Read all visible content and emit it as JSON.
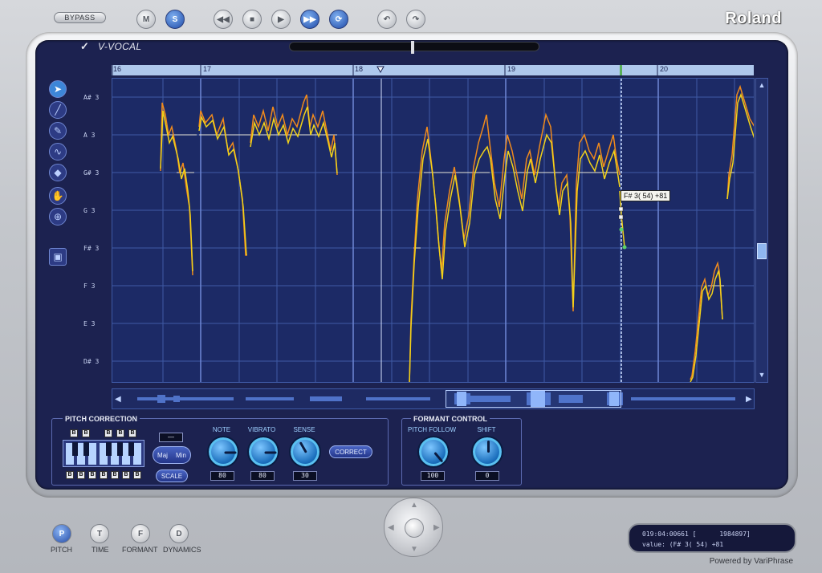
{
  "header": {
    "bypass_label": "BYPASS",
    "mute_label": "M",
    "solo_label": "S",
    "brand": "Roland",
    "plugin_title": "V-VOCAL"
  },
  "timeline": {
    "ruler_ticks": [
      "16",
      "17",
      "18",
      "19",
      "20"
    ]
  },
  "pitch_axis": {
    "labels": [
      "A# 3",
      "A 3",
      "G# 3",
      "G 3",
      "F# 3",
      "F 3",
      "E 3",
      "D# 3"
    ]
  },
  "tooltip": {
    "text": "F# 3( 54) +81"
  },
  "pitch_correction": {
    "title": "PITCH CORRECTION",
    "top_b_labels": [
      "B",
      "B",
      "B",
      "B",
      "B"
    ],
    "bottom_b_labels": [
      "B",
      "B",
      "B",
      "B",
      "B",
      "B",
      "B"
    ],
    "scale_value": "—",
    "maj_label": "Maj",
    "min_label": "Min",
    "scale_label": "SCALE",
    "correct_label": "CORRECT",
    "knobs": [
      {
        "label": "NOTE",
        "value": "80"
      },
      {
        "label": "VIBRATO",
        "value": "80"
      },
      {
        "label": "SENSE",
        "value": "30"
      }
    ]
  },
  "formant_control": {
    "title": "FORMANT CONTROL",
    "knobs": [
      {
        "label": "PITCH FOLLOW",
        "value": "100"
      },
      {
        "label": "SHIFT",
        "value": "0"
      }
    ]
  },
  "bottom_tabs": [
    {
      "letter": "P",
      "label": "PITCH"
    },
    {
      "letter": "T",
      "label": "TIME"
    },
    {
      "letter": "F",
      "label": "FORMANT"
    },
    {
      "letter": "D",
      "label": "DYNAMICS"
    }
  ],
  "readout": {
    "line1": "019:04:00661 [      1984897]",
    "line2": "value: (F# 3( 54) +81"
  },
  "footer": {
    "powered": "Powered by VariPhrase"
  },
  "colors": {
    "panel": "#1c2250",
    "plot": "#1c2a66",
    "pitch_orange": "#f08a1c",
    "pitch_yellow": "#f2d21a",
    "accent_blue": "#3d86d8"
  }
}
